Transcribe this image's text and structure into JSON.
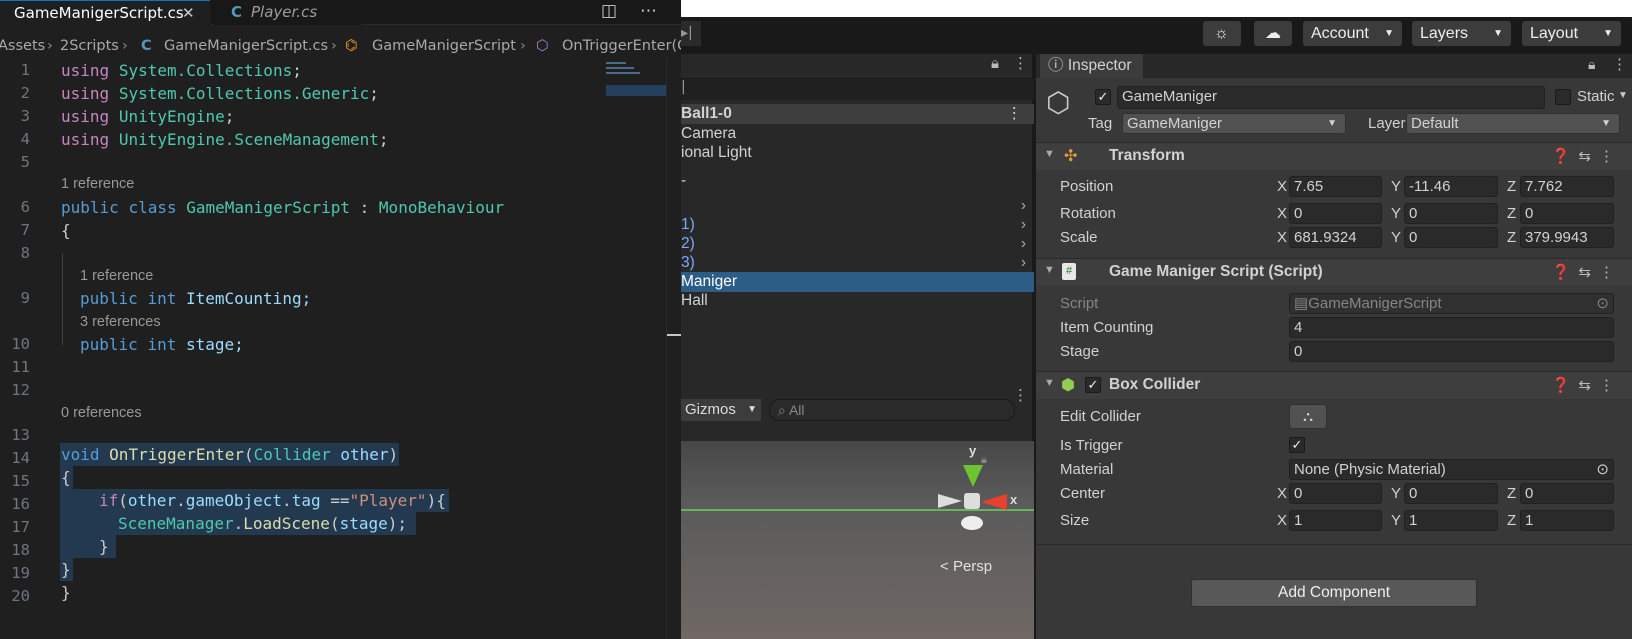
{
  "editor": {
    "tabs": [
      {
        "label": "GameManigerScript.cs",
        "close": "✕"
      },
      {
        "label": "Player.cs",
        "icon": "C"
      }
    ],
    "breadcrumb": [
      "Assets",
      "2Scripts",
      "GameManigerScript.cs",
      "GameManigerScript",
      "OnTriggerEnter(C"
    ],
    "line_numbers": [
      "1",
      "2",
      "3",
      "4",
      "5",
      "6",
      "7",
      "8",
      "9",
      "10",
      "11",
      "12",
      "13",
      "14",
      "15",
      "16",
      "17",
      "18",
      "19",
      "20"
    ],
    "codelens": {
      "l6": "1 reference",
      "l9": "1 reference",
      "l10": "3 references",
      "l13": "0 references"
    },
    "code": {
      "l1a": "using",
      "l1b": "System.Collections",
      "l2a": "using",
      "l2b": "System.Collections.Generic",
      "l3a": "using",
      "l3b": "UnityEngine",
      "l4a": "using",
      "l4b": "UnityEngine.SceneManagement",
      "l6a": "public",
      "l6b": "class",
      "l6c": "GameManigerScript",
      "l6d": "MonoBehaviour",
      "l7": "{",
      "l9a": "public",
      "l9b": "int",
      "l9c": "ItemCounting;",
      "l10a": "public",
      "l10b": "int",
      "l10c": "stage;",
      "l13a": "void",
      "l13b": "OnTriggerEnter",
      "l13c": "Collider",
      "l13d": "other",
      "l14": "{",
      "l15a": "if",
      "l15b": "other",
      "l15c": "gameObject",
      "l15d": "tag",
      "l15e": "\"Player\"",
      "l16a": "SceneManager",
      "l16b": "LoadScene",
      "l16c": "stage",
      "l17": "}",
      "l18": "}",
      "l19": "}"
    }
  },
  "unity": {
    "toolbar": {
      "account": "Account",
      "layers": "Layers",
      "layout": "Layout"
    },
    "hierarchy": {
      "root": "Ball1-0",
      "items": [
        "Camera",
        "ional Light",
        "-",
        "",
        "1)",
        "2)",
        "3)",
        "Maniger",
        "Hall"
      ]
    },
    "scene": {
      "gizmos": "Gizmos",
      "search_placeholder": "All",
      "persp": "Persp",
      "axis_y": "y",
      "axis_x": "x"
    },
    "inspector": {
      "tab": "Inspector",
      "name": "GameManiger",
      "static": "Static",
      "tag_label": "Tag",
      "tag": "GameManiger",
      "layer_label": "Layer",
      "layer": "Default",
      "transform": {
        "title": "Transform",
        "position": "Position",
        "rotation": "Rotation",
        "scale": "Scale",
        "pos": [
          "7.65",
          "-11.46",
          "7.762"
        ],
        "rot": [
          "0",
          "0",
          "0"
        ],
        "scl": [
          "681.9324",
          "0",
          "379.9943"
        ]
      },
      "script": {
        "title": "Game Maniger Script (Script)",
        "script_label": "Script",
        "script_value": "GameManigerScript",
        "item_label": "Item Counting",
        "item_value": "4",
        "stage_label": "Stage",
        "stage_value": "0"
      },
      "collider": {
        "title": "Box Collider",
        "edit": "Edit Collider",
        "trigger": "Is Trigger",
        "material_label": "Material",
        "material": "None (Physic Material)",
        "center": "Center",
        "size": "Size",
        "center_v": [
          "0",
          "0",
          "0"
        ],
        "size_v": [
          "1",
          "1",
          "1"
        ]
      },
      "axes": [
        "X",
        "Y",
        "Z"
      ],
      "add_component": "Add Component"
    }
  }
}
